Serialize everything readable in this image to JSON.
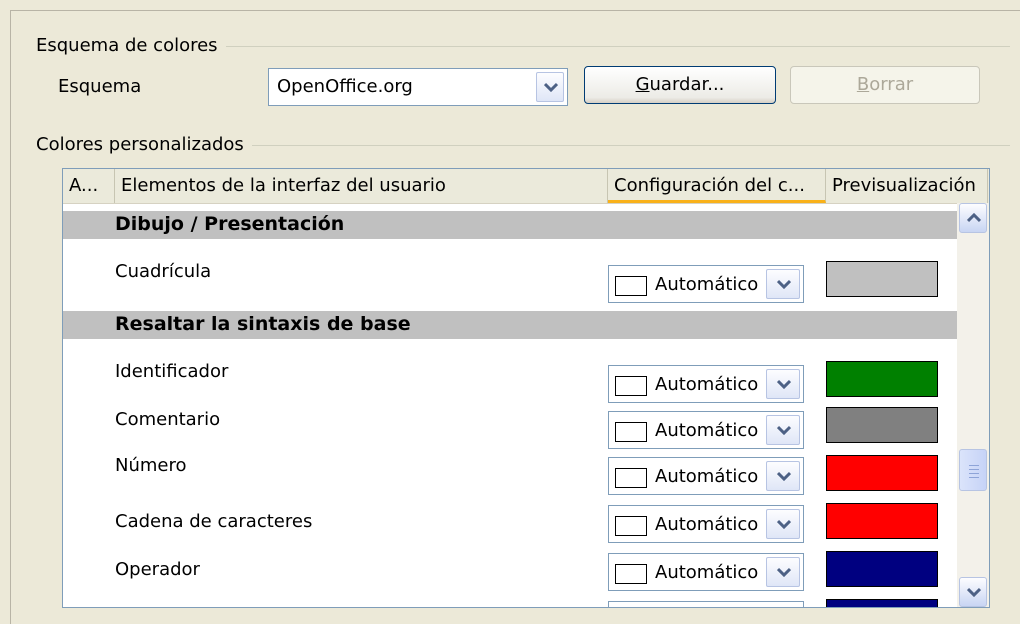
{
  "scheme_group": {
    "title": "Esquema de colores",
    "scheme_label": "Esquema",
    "scheme_value": "OpenOffice.org",
    "save_button": {
      "pre": "",
      "mnemonic": "G",
      "post": "uardar..."
    },
    "delete_button": {
      "pre": "",
      "mnemonic": "B",
      "post": "orrar"
    }
  },
  "custom_group": {
    "title": "Colores personalizados"
  },
  "table": {
    "columns": [
      "A...",
      "Elementos de la interfaz del usuario",
      "Configuración del c...",
      "Previsualización"
    ],
    "sections": [
      {
        "label": "Dibujo / Presentación"
      },
      {
        "label": "Resaltar la sintaxis de base"
      }
    ],
    "rows": [
      {
        "label": "Cuadrícula",
        "setting": "Automático",
        "preview_color": "#c0c0c0"
      },
      {
        "label": "Identificador",
        "setting": "Automático",
        "preview_color": "#008000"
      },
      {
        "label": "Comentario",
        "setting": "Automático",
        "preview_color": "#808080"
      },
      {
        "label": "Número",
        "setting": "Automático",
        "preview_color": "#ff0000"
      },
      {
        "label": "Cadena de caracteres",
        "setting": "Automático",
        "preview_color": "#ff0000"
      },
      {
        "label": "Operador",
        "setting": "Automático",
        "preview_color": "#000080"
      }
    ]
  },
  "icons": {
    "combo_arrow": "chevron-down-icon",
    "scroll_up": "chevron-up-icon",
    "scroll_down": "chevron-down-icon"
  }
}
